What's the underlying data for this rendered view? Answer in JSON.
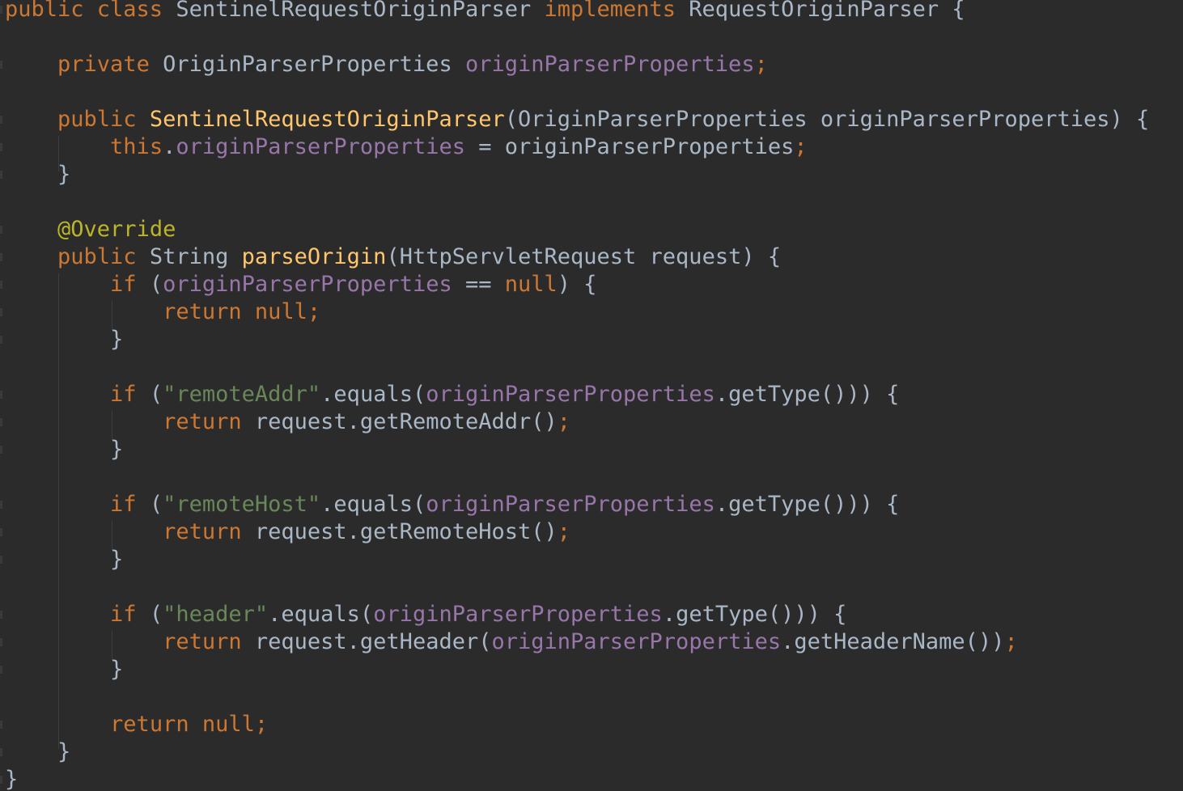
{
  "editor": {
    "theme": {
      "background": "#2b2b2b",
      "default": "#a9b7c6",
      "keyword": "#cc7832",
      "field": "#9876aa",
      "method_decl": "#ffc66d",
      "string": "#6a8759",
      "annotation": "#bbb529"
    },
    "lines": [
      [
        [
          "kw",
          "public class "
        ],
        [
          "txt",
          "SentinelRequestOriginParser "
        ],
        [
          "kw",
          "implements "
        ],
        [
          "txt",
          "RequestOriginParser {"
        ]
      ],
      [],
      [
        [
          "txt",
          "    "
        ],
        [
          "kw",
          "private "
        ],
        [
          "txt",
          "OriginParserProperties "
        ],
        [
          "fld",
          "originParserProperties"
        ],
        [
          "kw",
          ";"
        ]
      ],
      [],
      [
        [
          "txt",
          "    "
        ],
        [
          "kw",
          "public "
        ],
        [
          "fn",
          "SentinelRequestOriginParser"
        ],
        [
          "txt",
          "(OriginParserProperties originParserProperties) {"
        ]
      ],
      [
        [
          "txt",
          "        "
        ],
        [
          "kw",
          "this"
        ],
        [
          "txt",
          "."
        ],
        [
          "fld",
          "originParserProperties"
        ],
        [
          "txt",
          " = originParserProperties"
        ],
        [
          "kw",
          ";"
        ]
      ],
      [
        [
          "txt",
          "    }"
        ]
      ],
      [],
      [
        [
          "txt",
          "    "
        ],
        [
          "ann",
          "@Override"
        ]
      ],
      [
        [
          "txt",
          "    "
        ],
        [
          "kw",
          "public "
        ],
        [
          "txt",
          "String "
        ],
        [
          "fn",
          "parseOrigin"
        ],
        [
          "txt",
          "(HttpServletRequest request) {"
        ]
      ],
      [
        [
          "txt",
          "        "
        ],
        [
          "kw",
          "if "
        ],
        [
          "txt",
          "("
        ],
        [
          "fld",
          "originParserProperties"
        ],
        [
          "txt",
          " == "
        ],
        [
          "kw",
          "null"
        ],
        [
          "txt",
          ") {"
        ]
      ],
      [
        [
          "txt",
          "            "
        ],
        [
          "kw",
          "return null;"
        ]
      ],
      [
        [
          "txt",
          "        }"
        ]
      ],
      [],
      [
        [
          "txt",
          "        "
        ],
        [
          "kw",
          "if "
        ],
        [
          "txt",
          "("
        ],
        [
          "str",
          "\"remoteAddr\""
        ],
        [
          "txt",
          ".equals("
        ],
        [
          "fld",
          "originParserProperties"
        ],
        [
          "txt",
          ".getType())) {"
        ]
      ],
      [
        [
          "txt",
          "            "
        ],
        [
          "kw",
          "return "
        ],
        [
          "txt",
          "request.getRemoteAddr()"
        ],
        [
          "kw",
          ";"
        ]
      ],
      [
        [
          "txt",
          "        }"
        ]
      ],
      [],
      [
        [
          "txt",
          "        "
        ],
        [
          "kw",
          "if "
        ],
        [
          "txt",
          "("
        ],
        [
          "str",
          "\"remoteHost\""
        ],
        [
          "txt",
          ".equals("
        ],
        [
          "fld",
          "originParserProperties"
        ],
        [
          "txt",
          ".getType())) {"
        ]
      ],
      [
        [
          "txt",
          "            "
        ],
        [
          "kw",
          "return "
        ],
        [
          "txt",
          "request.getRemoteHost()"
        ],
        [
          "kw",
          ";"
        ]
      ],
      [
        [
          "txt",
          "        }"
        ]
      ],
      [],
      [
        [
          "txt",
          "        "
        ],
        [
          "kw",
          "if "
        ],
        [
          "txt",
          "("
        ],
        [
          "str",
          "\"header\""
        ],
        [
          "txt",
          ".equals("
        ],
        [
          "fld",
          "originParserProperties"
        ],
        [
          "txt",
          ".getType())) {"
        ]
      ],
      [
        [
          "txt",
          "            "
        ],
        [
          "kw",
          "return "
        ],
        [
          "txt",
          "request.getHeader("
        ],
        [
          "fld",
          "originParserProperties"
        ],
        [
          "txt",
          ".getHeaderName())"
        ],
        [
          "kw",
          ";"
        ]
      ],
      [
        [
          "txt",
          "        }"
        ]
      ],
      [],
      [
        [
          "txt",
          "        "
        ],
        [
          "kw",
          "return null;"
        ]
      ],
      [
        [
          "txt",
          "    }"
        ]
      ],
      [
        [
          "txt",
          "}"
        ]
      ]
    ]
  }
}
